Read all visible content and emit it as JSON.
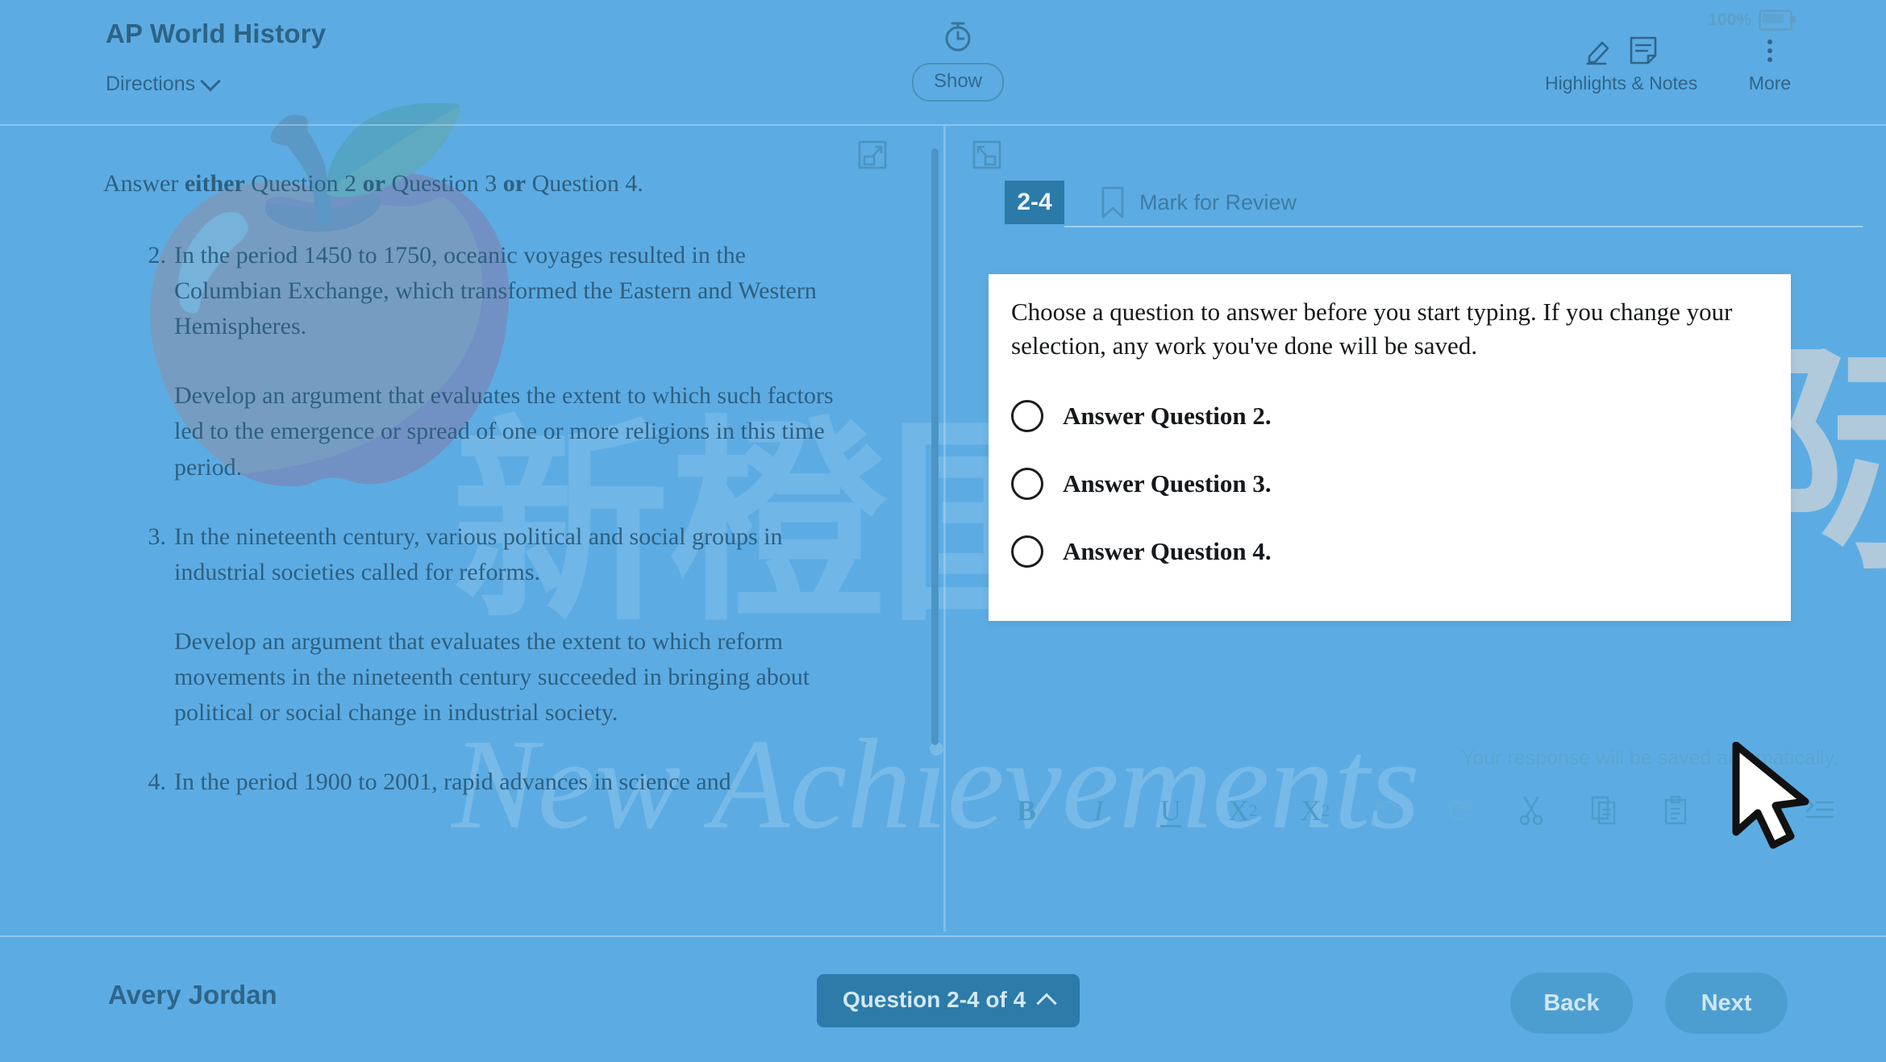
{
  "header": {
    "course_title": "AP World History",
    "directions_label": "Directions",
    "timer_icon": "stopwatch-icon",
    "show_label": "Show",
    "battery_percent": "100%",
    "highlights_notes_label": "Highlights & Notes",
    "more_label": "More"
  },
  "passage": {
    "lead_prefix": "Answer ",
    "lead_either": "either",
    "lead_mid1": " Question 2 ",
    "lead_or1": "or",
    "lead_mid2": " Question 3 ",
    "lead_or2": "or",
    "lead_end": " Question 4.",
    "questions": [
      {
        "num": "2.",
        "stem": "In the period 1450 to 1750, oceanic voyages resulted in the Columbian Exchange, which transformed the Eastern and Western Hemispheres.",
        "prompt": "Develop an argument that evaluates the extent to which such factors led to the emergence or spread of one or more religions in this time period."
      },
      {
        "num": "3.",
        "stem": "In the nineteenth century, various political and social groups in industrial societies called for reforms.",
        "prompt": "Develop an argument that evaluates the extent to which reform movements in the nineteenth century succeeded in bringing about political or social change in industrial society."
      },
      {
        "num": "4.",
        "stem": "In the period 1900 to 2001, rapid advances in science and",
        "prompt": ""
      }
    ]
  },
  "question_panel": {
    "badge": "2-4",
    "mark_for_review_label": "Mark for Review",
    "autosave_note": "Your response will be saved automatically.",
    "toolbar": [
      {
        "name": "bold-icon",
        "glyph": "B"
      },
      {
        "name": "italic-icon",
        "glyph": "I"
      },
      {
        "name": "underline-icon",
        "glyph": "U"
      },
      {
        "name": "superscript-icon",
        "glyph": "X2"
      },
      {
        "name": "subscript-icon",
        "glyph": "X2"
      },
      {
        "name": "undo-icon",
        "glyph": "undo"
      },
      {
        "name": "redo-icon",
        "glyph": "redo"
      },
      {
        "name": "cut-icon",
        "glyph": "scissors"
      },
      {
        "name": "copy-icon",
        "glyph": "copy"
      },
      {
        "name": "paste-icon",
        "glyph": "paste"
      },
      {
        "name": "special-character-icon",
        "glyph": "Ω"
      },
      {
        "name": "indent-icon",
        "glyph": "indent"
      }
    ]
  },
  "modal": {
    "message": "Choose a question to answer before you start typing. If you change your selection, any work you've done will be saved.",
    "options": [
      {
        "label": "Answer Question 2.",
        "selected": false
      },
      {
        "label": "Answer Question 3.",
        "selected": false
      },
      {
        "label": "Answer Question 4.",
        "selected": false
      }
    ]
  },
  "footer": {
    "student_name": "Avery Jordan",
    "question_nav_label": "Question 2-4 of 4",
    "back_label": "Back",
    "next_label": "Next"
  },
  "watermarks": {
    "script_text": "New Achievements",
    "cn_text_1": "新橙国际",
    "cn_text_blue": "新橙国际"
  },
  "colors": {
    "page_bg": "#5cace3",
    "accent_dark": "#2b7aa8",
    "text_blue": "#2f658a",
    "modal_bg": "#ffffff",
    "watermark_peach": "#f6e2d6"
  }
}
